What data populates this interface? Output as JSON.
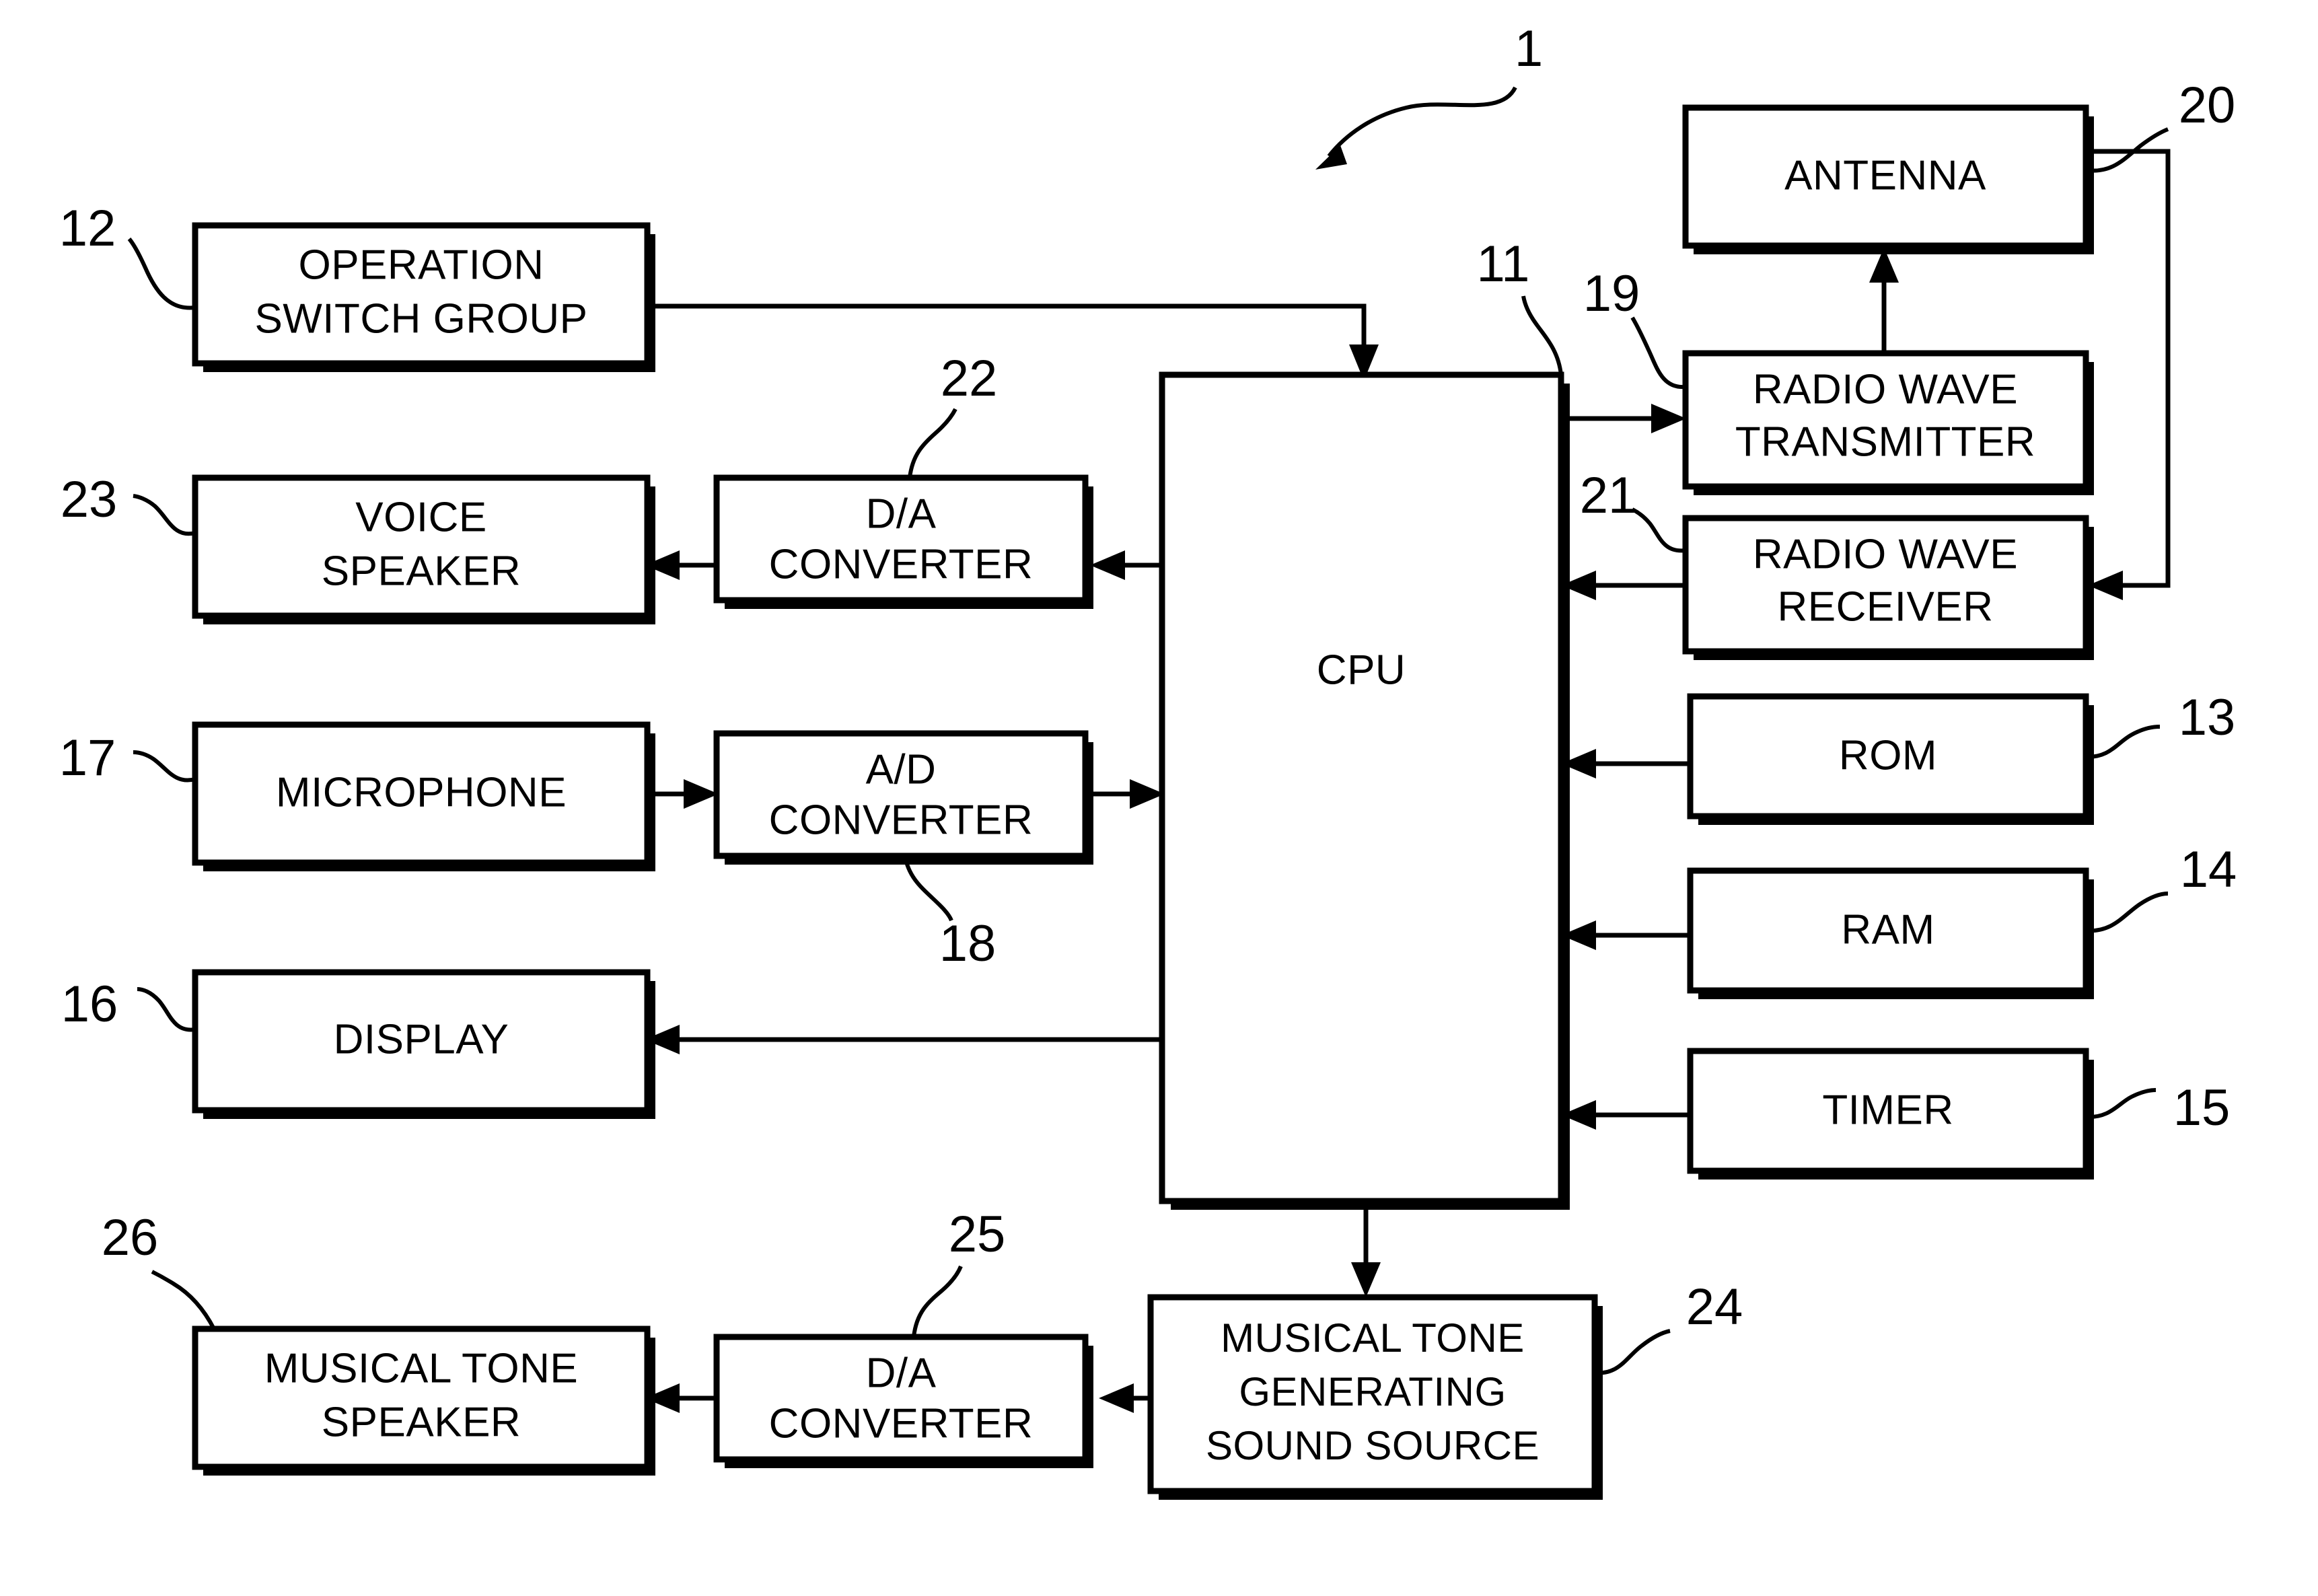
{
  "figure": {
    "type": "patent-block-diagram",
    "system_reference": "1",
    "background_color": "#ffffff",
    "line_color": "#000000"
  },
  "blocks": [
    {
      "id": "operation-switch-group",
      "label_lines": [
        "OPERATION",
        "SWITCH GROUP"
      ],
      "ref": "12"
    },
    {
      "id": "voice-speaker",
      "label_lines": [
        "VOICE",
        "SPEAKER"
      ],
      "ref": "23"
    },
    {
      "id": "microphone",
      "label_lines": [
        "MICROPHONE"
      ],
      "ref": "17"
    },
    {
      "id": "display",
      "label_lines": [
        "DISPLAY"
      ],
      "ref": "16"
    },
    {
      "id": "musical-tone-speaker",
      "label_lines": [
        "MUSICAL TONE",
        "SPEAKER"
      ],
      "ref": "26"
    },
    {
      "id": "da-converter-voice",
      "label_lines": [
        "D/A",
        "CONVERTER"
      ],
      "ref": "22"
    },
    {
      "id": "ad-converter",
      "label_lines": [
        "A/D",
        "CONVERTER"
      ],
      "ref": "18"
    },
    {
      "id": "da-converter-tone",
      "label_lines": [
        "D/A",
        "CONVERTER"
      ],
      "ref": "25"
    },
    {
      "id": "cpu",
      "label_lines": [
        "CPU"
      ],
      "ref": "11"
    },
    {
      "id": "antenna",
      "label_lines": [
        "ANTENNA"
      ],
      "ref": "20"
    },
    {
      "id": "radio-wave-transmitter",
      "label_lines": [
        "RADIO WAVE",
        "TRANSMITTER"
      ],
      "ref": "19"
    },
    {
      "id": "radio-wave-receiver",
      "label_lines": [
        "RADIO WAVE",
        "RECEIVER"
      ],
      "ref": "21"
    },
    {
      "id": "rom",
      "label_lines": [
        "ROM"
      ],
      "ref": "13"
    },
    {
      "id": "ram",
      "label_lines": [
        "RAM"
      ],
      "ref": "14"
    },
    {
      "id": "timer",
      "label_lines": [
        "TIMER"
      ],
      "ref": "15"
    },
    {
      "id": "musical-tone-generating-sound-source",
      "label_lines": [
        "MUSICAL TONE",
        "GENERATING",
        "SOUND SOURCE"
      ],
      "ref": "24"
    }
  ],
  "text": {
    "operation_switch_group_l1": "OPERATION",
    "operation_switch_group_l2": "SWITCH GROUP",
    "voice_speaker_l1": "VOICE",
    "voice_speaker_l2": "SPEAKER",
    "microphone_l1": "MICROPHONE",
    "display_l1": "DISPLAY",
    "musical_tone_speaker_l1": "MUSICAL TONE",
    "musical_tone_speaker_l2": "SPEAKER",
    "da_converter_voice_l1": "D/A",
    "da_converter_voice_l2": "CONVERTER",
    "ad_converter_l1": "A/D",
    "ad_converter_l2": "CONVERTER",
    "da_converter_tone_l1": "D/A",
    "da_converter_tone_l2": "CONVERTER",
    "cpu_l1": "CPU",
    "antenna_l1": "ANTENNA",
    "radio_wave_transmitter_l1": "RADIO WAVE",
    "radio_wave_transmitter_l2": "TRANSMITTER",
    "radio_wave_receiver_l1": "RADIO WAVE",
    "radio_wave_receiver_l2": "RECEIVER",
    "rom_l1": "ROM",
    "ram_l1": "RAM",
    "timer_l1": "TIMER",
    "mtgss_l1": "MUSICAL TONE",
    "mtgss_l2": "GENERATING",
    "mtgss_l3": "SOUND SOURCE"
  },
  "refs": {
    "system": "1",
    "cpu": "11",
    "operation_switch_group": "12",
    "rom": "13",
    "ram": "14",
    "timer": "15",
    "display": "16",
    "microphone": "17",
    "ad_converter": "18",
    "radio_wave_transmitter": "19",
    "antenna": "20",
    "radio_wave_receiver": "21",
    "da_converter_voice": "22",
    "voice_speaker": "23",
    "musical_tone_generating_sound_source": "24",
    "da_converter_tone": "25",
    "musical_tone_speaker": "26"
  },
  "connections": [
    {
      "from": "operation-switch-group",
      "to": "cpu",
      "direction": "down-into-top"
    },
    {
      "from": "cpu",
      "to": "da-converter-voice",
      "direction": "left"
    },
    {
      "from": "da-converter-voice",
      "to": "voice-speaker",
      "direction": "left"
    },
    {
      "from": "microphone",
      "to": "ad-converter",
      "direction": "right"
    },
    {
      "from": "ad-converter",
      "to": "cpu",
      "direction": "right"
    },
    {
      "from": "cpu",
      "to": "display",
      "direction": "left"
    },
    {
      "from": "cpu",
      "to": "radio-wave-transmitter",
      "direction": "right"
    },
    {
      "from": "radio-wave-transmitter",
      "to": "antenna",
      "direction": "up"
    },
    {
      "from": "antenna",
      "to": "radio-wave-receiver",
      "direction": "right-down-left"
    },
    {
      "from": "radio-wave-receiver",
      "to": "cpu",
      "direction": "left"
    },
    {
      "from": "rom",
      "to": "cpu",
      "direction": "left"
    },
    {
      "from": "ram",
      "to": "cpu",
      "direction": "left"
    },
    {
      "from": "timer",
      "to": "cpu",
      "direction": "left"
    },
    {
      "from": "cpu",
      "to": "musical-tone-generating-sound-source",
      "direction": "down"
    },
    {
      "from": "musical-tone-generating-sound-source",
      "to": "da-converter-tone",
      "direction": "left"
    },
    {
      "from": "da-converter-tone",
      "to": "musical-tone-speaker",
      "direction": "left"
    }
  ]
}
